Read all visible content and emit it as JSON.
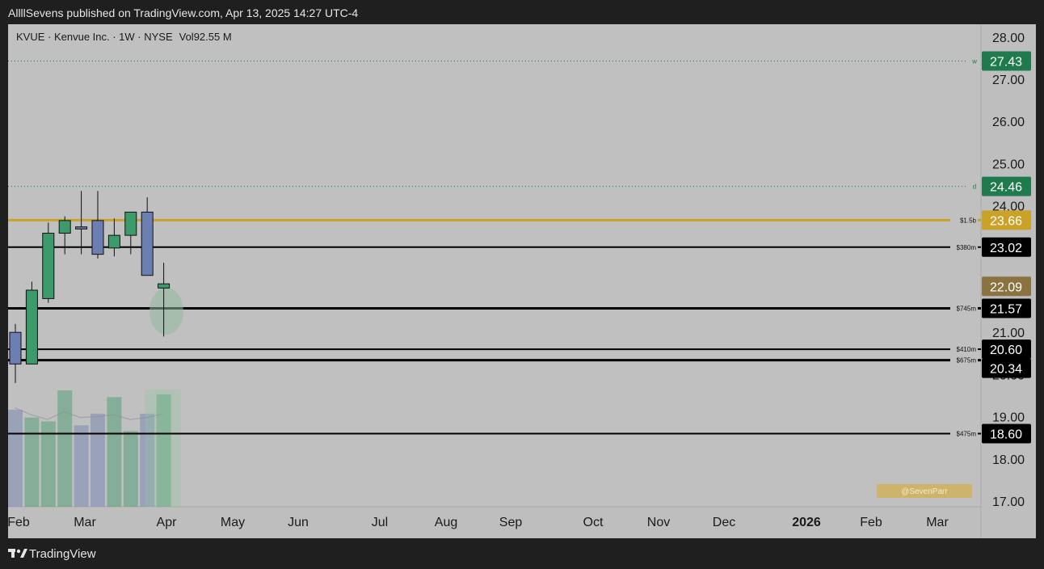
{
  "header": {
    "publish_line": "AllllSevens published on TradingView.com, Apr 13, 2025 14:27 UTC-4"
  },
  "legend": {
    "symbol_line": "KVUE · Kenvue Inc. · 1W · NYSE",
    "volume_label": "Vol",
    "volume_value": "92.55 M"
  },
  "footer": {
    "brand": "TradingView"
  },
  "watermark": "@SevenParr",
  "colors": {
    "up": "#3d9a6a",
    "down": "#6c7fb3",
    "gold": "#c9a227",
    "green_tag": "#1f7a4d",
    "black": "#000000"
  },
  "chart_data": {
    "type": "candlestick",
    "timeframe": "1W",
    "y_axis": {
      "ticks": [
        "17.00",
        "18.00",
        "19.00",
        "20.00",
        "21.00",
        "22.00",
        "23.00",
        "24.00",
        "25.00",
        "26.00",
        "27.00",
        "28.00"
      ],
      "ylim": [
        16.8,
        28.3
      ]
    },
    "x_axis": {
      "ticks": [
        "Feb",
        "Mar",
        "Apr",
        "May",
        "Jun",
        "Jul",
        "Aug",
        "Sep",
        "Oct",
        "Nov",
        "Dec",
        "2026",
        "Feb",
        "Mar"
      ]
    },
    "candles": [
      {
        "o": 21.0,
        "h": 21.2,
        "l": 19.8,
        "c": 20.25,
        "vol": 1.0
      },
      {
        "o": 20.25,
        "h": 22.2,
        "l": 20.25,
        "c": 22.0,
        "vol": 0.92
      },
      {
        "o": 21.8,
        "h": 23.6,
        "l": 21.7,
        "c": 23.35,
        "vol": 0.88
      },
      {
        "o": 23.35,
        "h": 23.75,
        "l": 22.85,
        "c": 23.65,
        "vol": 1.2
      },
      {
        "o": 23.5,
        "h": 24.35,
        "l": 22.85,
        "c": 23.45,
        "vol": 0.84
      },
      {
        "o": 23.65,
        "h": 24.35,
        "l": 22.75,
        "c": 22.85,
        "vol": 0.96
      },
      {
        "o": 23.0,
        "h": 23.7,
        "l": 22.8,
        "c": 23.3,
        "vol": 1.13
      },
      {
        "o": 23.3,
        "h": 23.75,
        "l": 22.85,
        "c": 23.85,
        "vol": 0.78
      },
      {
        "o": 23.85,
        "h": 24.2,
        "l": 22.4,
        "c": 22.35,
        "vol": 0.96
      },
      {
        "o": 22.05,
        "h": 22.65,
        "l": 20.9,
        "c": 22.15,
        "vol": 1.16
      }
    ],
    "volume_ma": [
      1.02,
      0.95,
      0.9,
      0.98,
      0.92,
      0.93,
      0.95,
      0.9,
      0.92,
      0.96
    ],
    "horizontal_levels": [
      {
        "price": 27.43,
        "style": "dotted",
        "color": "#1f7a4d",
        "marker": "w"
      },
      {
        "price": 24.46,
        "style": "dotted",
        "color": "#1f7a4d",
        "marker": "d"
      },
      {
        "price": 23.66,
        "style": "solid-thick",
        "color": "#c9a227",
        "label": "$1.5b"
      },
      {
        "price": 23.02,
        "style": "solid",
        "color": "#000000",
        "label": "$380m"
      },
      {
        "price": 21.57,
        "style": "solid-thick",
        "color": "#000000",
        "label": "$745m"
      },
      {
        "price": 20.6,
        "style": "solid",
        "color": "#000000",
        "label": "$410m"
      },
      {
        "price": 20.34,
        "style": "solid-thick",
        "color": "#000000",
        "label": "$675m"
      },
      {
        "price": 18.6,
        "style": "solid",
        "color": "#000000",
        "label": "$475m"
      }
    ],
    "price_tags": [
      {
        "text": "27.43",
        "price": 27.43,
        "bg": "#1f7a4d"
      },
      {
        "text": "24.46",
        "price": 24.46,
        "bg": "#1f7a4d"
      },
      {
        "text": "23.66",
        "price": 23.66,
        "bg": "#c9a227"
      },
      {
        "text": "23.02",
        "price": 23.02,
        "bg": "#000000"
      },
      {
        "text": "22.09",
        "price": 22.09,
        "bg": "#8a7340"
      },
      {
        "text": "21.57",
        "price": 21.57,
        "bg": "#000000"
      },
      {
        "text": "20.60",
        "price": 20.6,
        "bg": "#000000"
      },
      {
        "text": "20.34",
        "price": 20.15,
        "bg": "#000000"
      },
      {
        "text": "18.60",
        "price": 18.6,
        "bg": "#000000"
      }
    ]
  }
}
